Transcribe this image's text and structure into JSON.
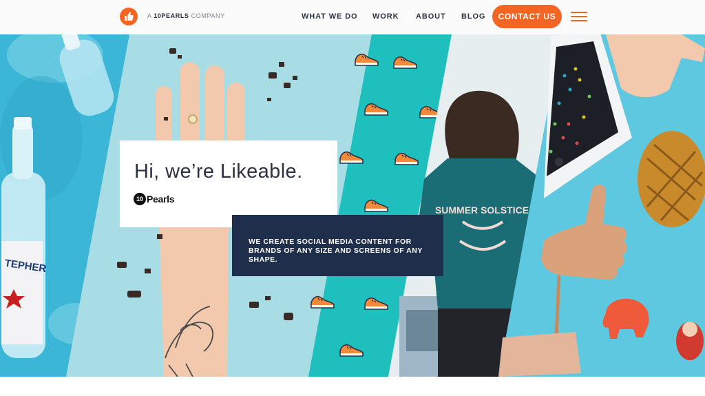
{
  "header": {
    "company_prefix": "A",
    "company_name": "10PEARLS",
    "company_suffix": "COMPANY",
    "nav": [
      {
        "label": "WHAT WE DO"
      },
      {
        "label": "WORK"
      },
      {
        "label": "ABOUT"
      },
      {
        "label": "BLOG"
      }
    ],
    "contact_label": "CONTACT US"
  },
  "hero": {
    "headline": "Hi, we’re Likeable.",
    "brand_badge": "10",
    "brand_word": "Pearls",
    "tagline": "WE CREATE SOCIAL MEDIA CONTENT FOR BRANDS OF ANY SIZE AND SCREENS OF ANY SHAPE.",
    "shirt_text": "SUMMER SOLSTICE",
    "bottle_label": "TEPHER"
  },
  "colors": {
    "accent": "#f26522",
    "navy": "#1f2f4b",
    "text_dark": "#2d3142",
    "teal": "#1ebfbd",
    "sky": "#5ec8e0",
    "pale_blue": "#a9dde6"
  },
  "icons": {
    "logo": "thumbs-up-icon",
    "menu": "hamburger-menu-icon"
  }
}
